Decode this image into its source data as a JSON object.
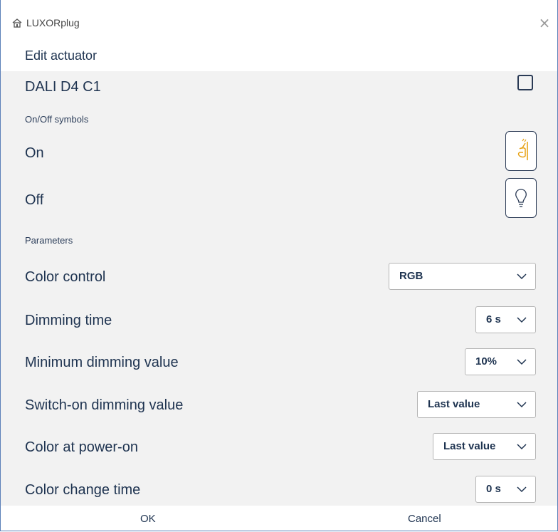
{
  "window": {
    "app_title": "LUXORplug",
    "app_icon": "home-icon",
    "close_icon": "close-icon",
    "close_glyph": "×"
  },
  "header": {
    "title": "Edit actuator"
  },
  "actuator": {
    "name": "DALI D4 C1",
    "checked": false
  },
  "symbols": {
    "section_label": "On/Off symbols",
    "on_label": "On",
    "on_icon": "switch-on-icon",
    "off_label": "Off",
    "off_icon": "lightbulb-icon",
    "on_icon_color": "#e8a317",
    "off_icon_color": "#2a3a55"
  },
  "parameters": {
    "section_label": "Parameters",
    "rows": [
      {
        "label": "Color control",
        "value": "RGB"
      },
      {
        "label": "Dimming time",
        "value": "6 s"
      },
      {
        "label": "Minimum dimming value",
        "value": "10%"
      },
      {
        "label": "Switch-on dimming value",
        "value": "Last value"
      },
      {
        "label": "Color at power-on",
        "value": "Last value"
      },
      {
        "label": "Color change time",
        "value": "0 s"
      }
    ]
  },
  "footer": {
    "ok_label": "OK",
    "cancel_label": "Cancel"
  },
  "colors": {
    "accent": "#1e3350",
    "border": "#5a7fb8",
    "panel": "#f2f2f2"
  }
}
